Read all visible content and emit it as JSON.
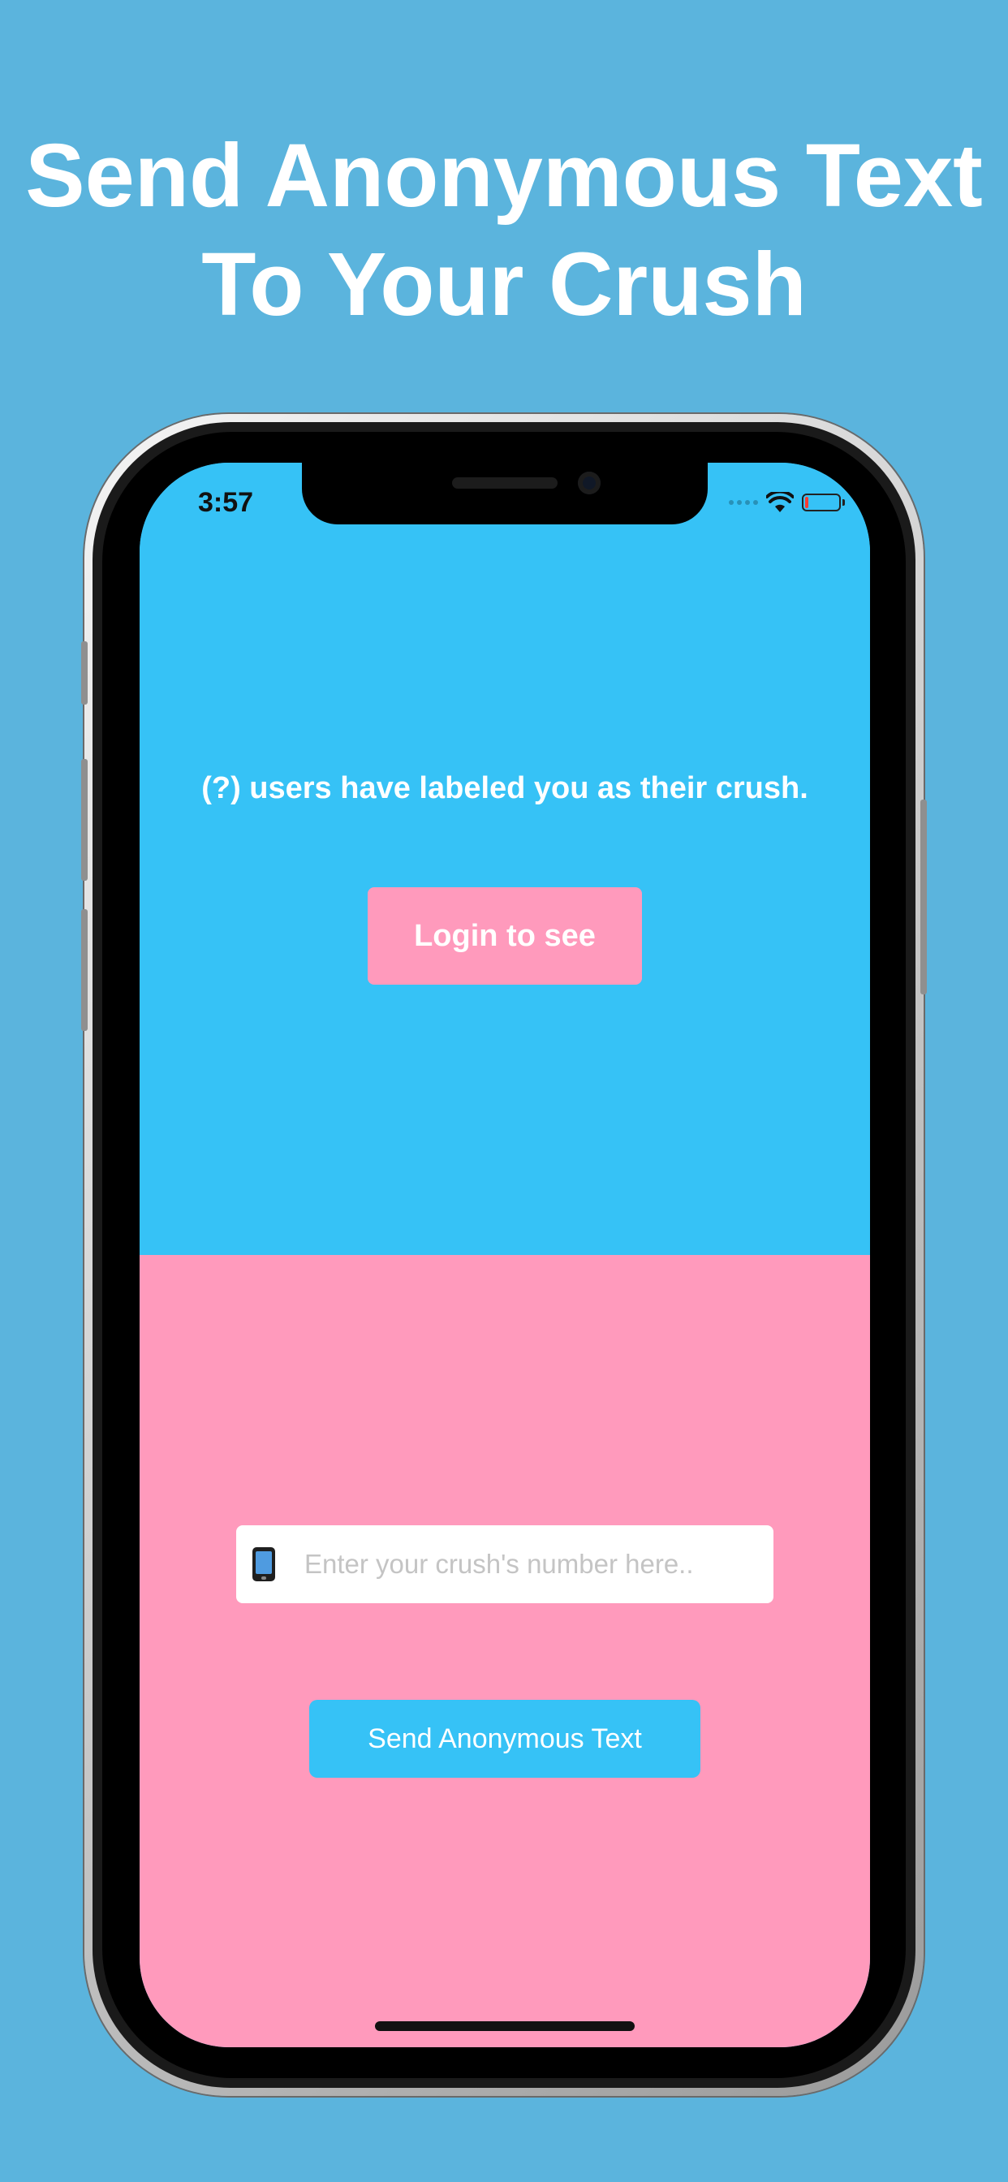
{
  "promo": {
    "headline_line1": "Send Anonymous Text",
    "headline_line2": "To Your Crush"
  },
  "status_bar": {
    "time": "3:57",
    "icons": [
      "wifi-icon",
      "battery-icon"
    ],
    "battery_level": 0.1
  },
  "top_section": {
    "message": "(?) users have labeled you as their crush.",
    "login_button_label": "Login to see"
  },
  "bottom_section": {
    "number_field": {
      "icon": "mobile-phone-icon",
      "placeholder": "Enter your crush's number here..",
      "value": ""
    },
    "send_button_label": "Send Anonymous Text"
  },
  "colors": {
    "background": "#5bb4dd",
    "top_panel": "#36c2f6",
    "bottom_panel": "#ff9abc",
    "battery_low": "#ff3b30"
  }
}
